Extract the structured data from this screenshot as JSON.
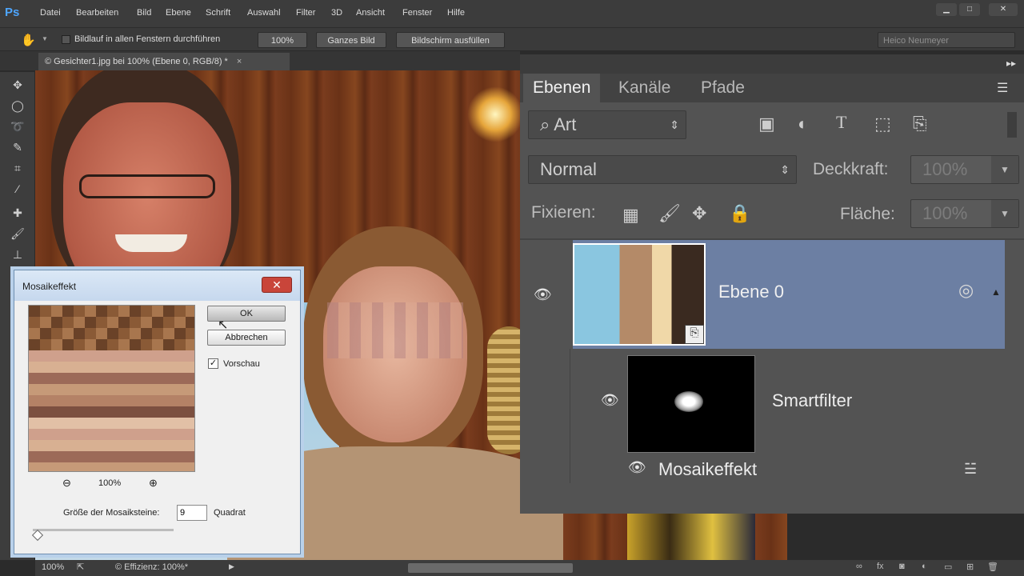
{
  "app": {
    "logo": "Ps"
  },
  "menu": [
    "Datei",
    "Bearbeiten",
    "Bild",
    "Ebene",
    "Schrift",
    "Auswahl",
    "Filter",
    "3D",
    "Ansicht",
    "Fenster",
    "Hilfe"
  ],
  "window_controls": {
    "minimize": "▁",
    "maximize": "□",
    "close": "✕"
  },
  "options": {
    "scroll_all_label": "Bildlauf in allen Fenstern durchführen",
    "zoom_100": "100%",
    "fit_screen": "Ganzes Bild",
    "fill_screen": "Bildschirm ausfüllen",
    "user": "Heico Neumeyer"
  },
  "document_tab": {
    "title": "© Gesichter1.jpg bei 100% (Ebene 0, RGB/8) *",
    "close": "×"
  },
  "status": {
    "zoom": "100%",
    "efficiency": "© Effizienz: 100%*"
  },
  "dialog": {
    "title": "Mosaikeffekt",
    "ok": "OK",
    "cancel": "Abbrechen",
    "preview_label": "Vorschau",
    "preview_checked": true,
    "zoom": "100%",
    "cell_size_label": "Größe der Mosaiksteine:",
    "cell_size_value": "9",
    "cell_size_unit": "Quadrat"
  },
  "panel": {
    "tabs": [
      "Ebenen",
      "Kanäle",
      "Pfade"
    ],
    "filter_kind": "Art",
    "blend_mode": "Normal",
    "opacity_label": "Deckkraft:",
    "opacity_value": "100%",
    "lock_label": "Fixieren:",
    "fill_label": "Fläche:",
    "fill_value": "100%",
    "layer_name": "Ebene 0",
    "smart_filter_label": "Smartfilter",
    "filter_name": "Mosaikeffekt"
  },
  "colors": {
    "accent": "#4ea6ff",
    "selected_layer": "#6c7fa3",
    "panel_bg": "#535353"
  }
}
